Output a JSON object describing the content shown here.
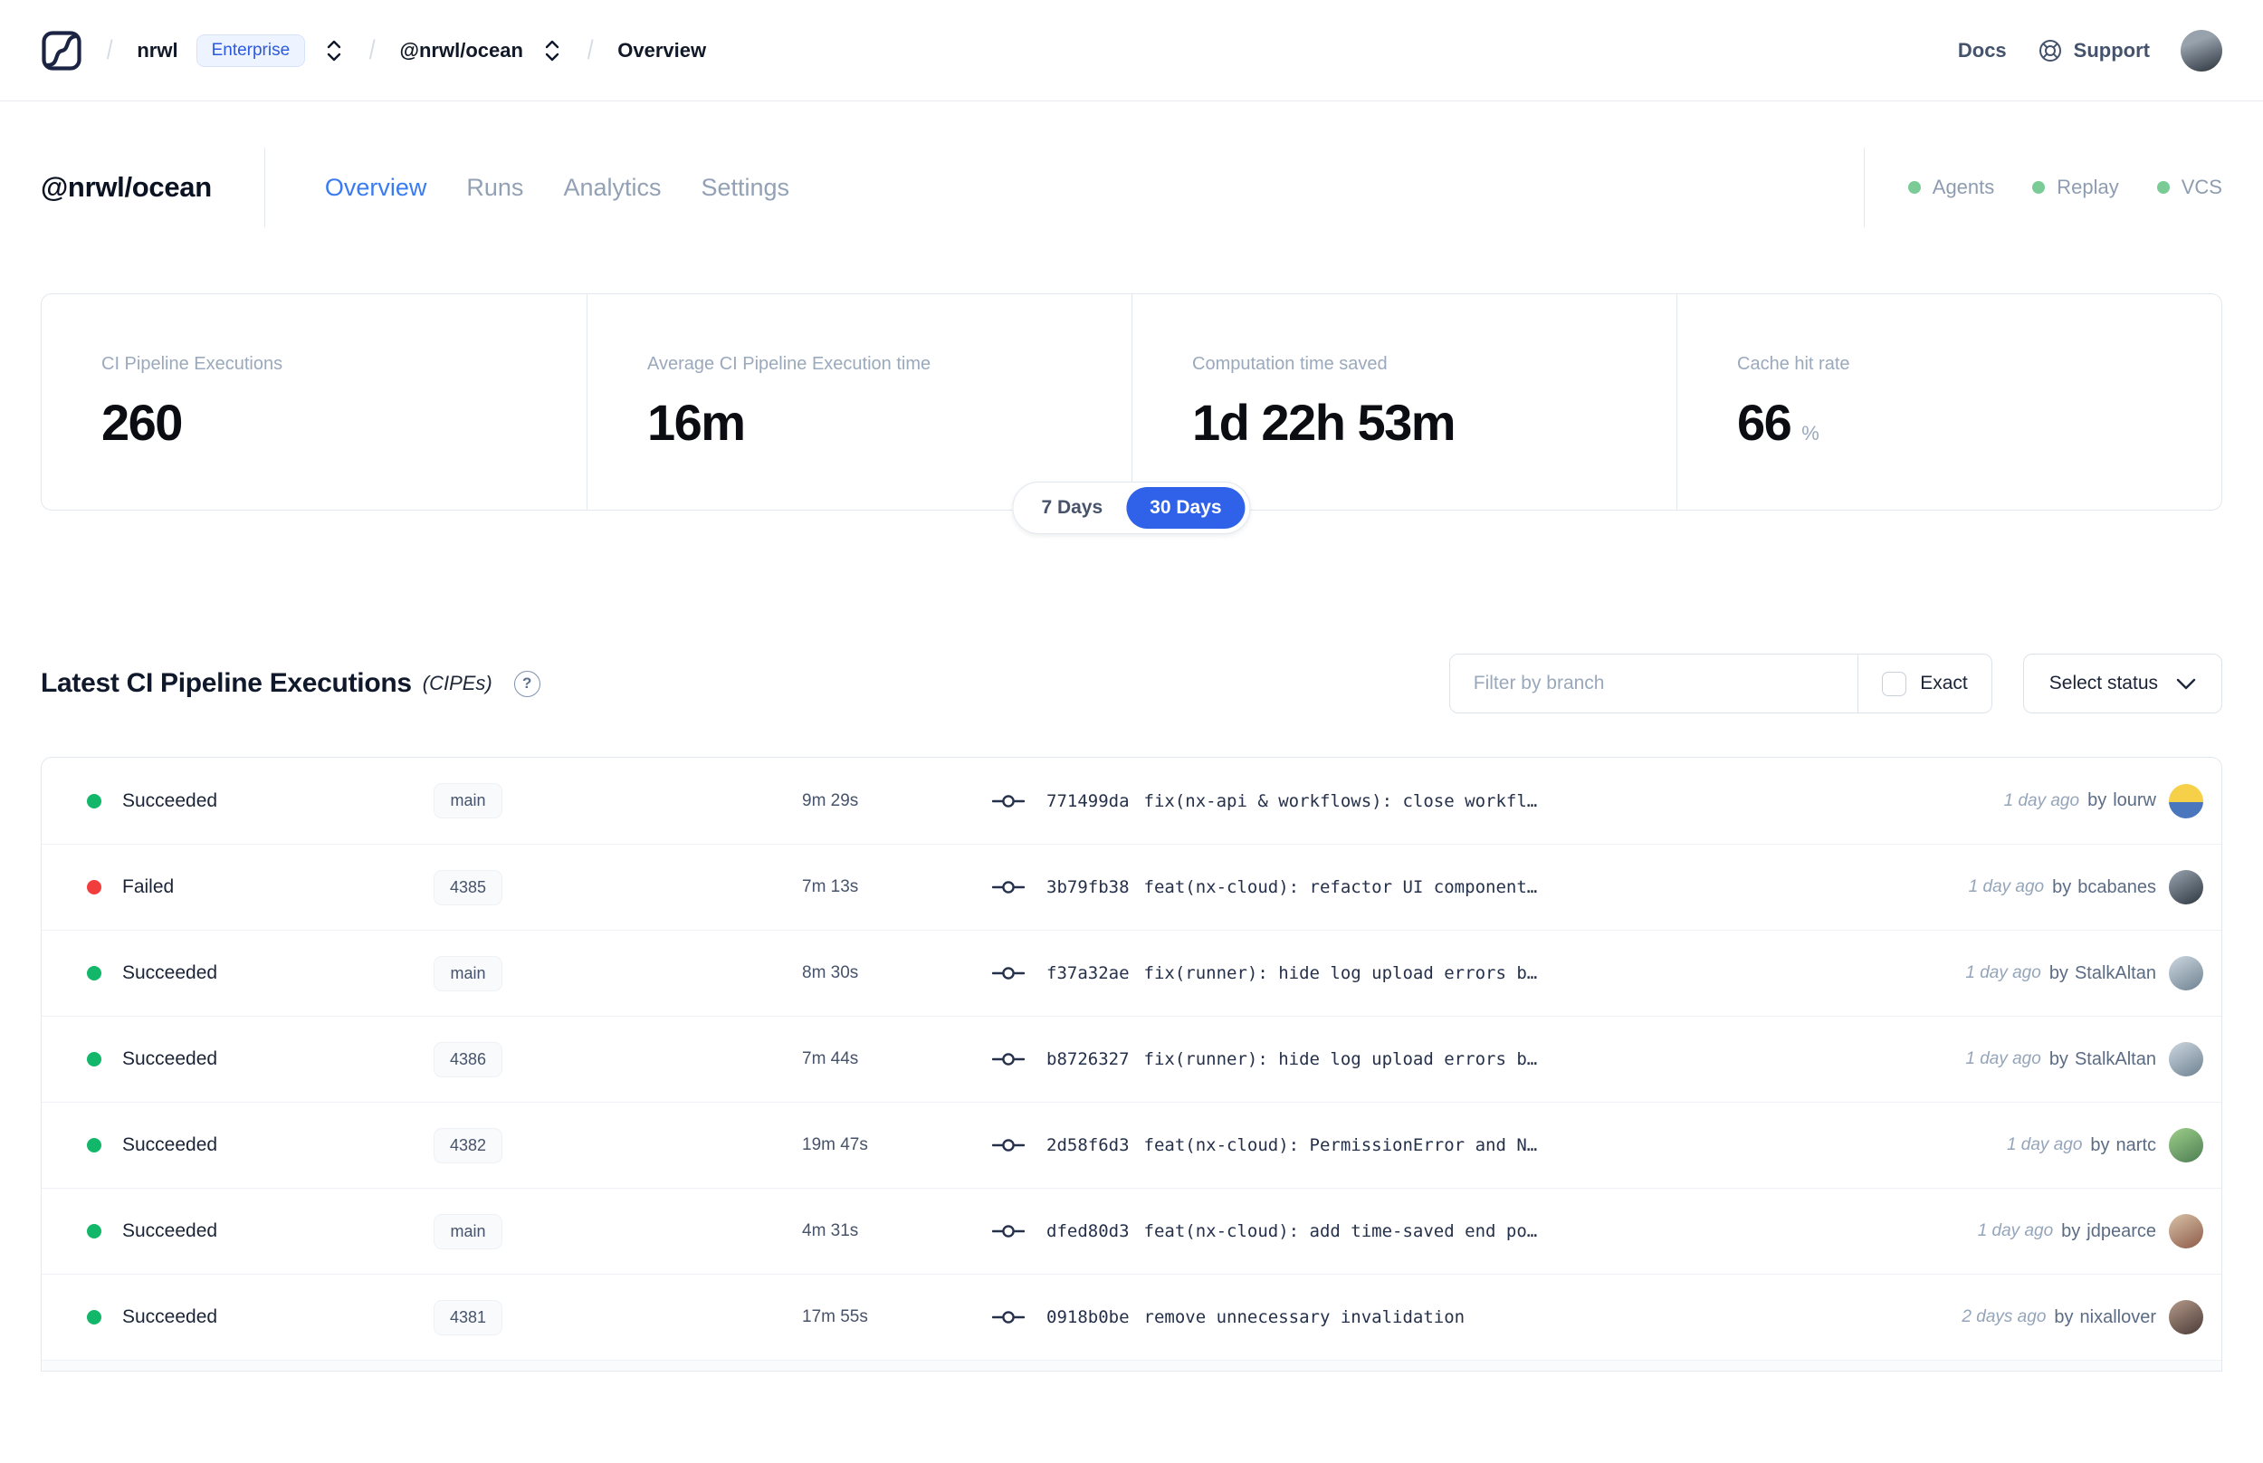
{
  "navbar": {
    "org": "nrwl",
    "plan_badge": "Enterprise",
    "workspace": "@nrwl/ocean",
    "page": "Overview",
    "docs_label": "Docs",
    "support_label": "Support",
    "avatar": {
      "from": "#97a2ac",
      "to": "#2b323c"
    }
  },
  "header": {
    "title": "@nrwl/ocean",
    "tabs": [
      {
        "label": "Overview",
        "active": true
      },
      {
        "label": "Runs",
        "active": false
      },
      {
        "label": "Analytics",
        "active": false
      },
      {
        "label": "Settings",
        "active": false
      }
    ],
    "services": [
      {
        "label": "Agents"
      },
      {
        "label": "Replay"
      },
      {
        "label": "VCS"
      }
    ]
  },
  "stats": {
    "cards": [
      {
        "label": "CI Pipeline Executions",
        "value": "260"
      },
      {
        "label": "Average CI Pipeline Execution time",
        "value": "16m"
      },
      {
        "label": "Computation time saved",
        "value": "1d 22h 53m"
      },
      {
        "label": "Cache hit rate",
        "value": "66",
        "unit": "%"
      }
    ],
    "range_toggle": {
      "options": [
        "7 Days",
        "30 Days"
      ],
      "selected": "30 Days"
    }
  },
  "cipes": {
    "title": "Latest CI Pipeline Executions",
    "subtitle": "(CIPEs)",
    "help_icon": "?",
    "by_label": "by",
    "filter": {
      "placeholder": "Filter by branch",
      "exact_label": "Exact",
      "status_label": "Select status"
    },
    "rows": [
      {
        "status": "Succeeded",
        "status_color": "#12b76a",
        "branch": "main",
        "duration": "9m 29s",
        "hash": "771499da",
        "message": "fix(nx-api & workflows): close workfl…",
        "time_ago": "1 day ago",
        "author": "lourw",
        "avatar": {
          "from": "#f6d049",
          "to": "#4a76bd",
          "split": true
        }
      },
      {
        "status": "Failed",
        "status_color": "#f23d3d",
        "branch": "4385",
        "duration": "7m 13s",
        "hash": "3b79fb38",
        "message": "feat(nx-cloud): refactor UI component…",
        "time_ago": "1 day ago",
        "author": "bcabanes",
        "avatar": {
          "from": "#9aa5b1",
          "to": "#2e3740"
        }
      },
      {
        "status": "Succeeded",
        "status_color": "#12b76a",
        "branch": "main",
        "duration": "8m 30s",
        "hash": "f37a32ae",
        "message": "fix(runner): hide log upload errors b…",
        "time_ago": "1 day ago",
        "author": "StalkAltan",
        "avatar": {
          "from": "#cdd8e0",
          "to": "#6e8191"
        }
      },
      {
        "status": "Succeeded",
        "status_color": "#12b76a",
        "branch": "4386",
        "duration": "7m 44s",
        "hash": "b8726327",
        "message": "fix(runner): hide log upload errors b…",
        "time_ago": "1 day ago",
        "author": "StalkAltan",
        "avatar": {
          "from": "#cdd8e0",
          "to": "#6e8191"
        }
      },
      {
        "status": "Succeeded",
        "status_color": "#12b76a",
        "branch": "4382",
        "duration": "19m 47s",
        "hash": "2d58f6d3",
        "message": "feat(nx-cloud): PermissionError and N…",
        "time_ago": "1 day ago",
        "author": "nartc",
        "avatar": {
          "from": "#9ecf8a",
          "to": "#4c7d52"
        }
      },
      {
        "status": "Succeeded",
        "status_color": "#12b76a",
        "branch": "main",
        "duration": "4m 31s",
        "hash": "dfed80d3",
        "message": "feat(nx-cloud): add time-saved end po…",
        "time_ago": "1 day ago",
        "author": "jdpearce",
        "avatar": {
          "from": "#d9c2a8",
          "to": "#8c5a48"
        }
      },
      {
        "status": "Succeeded",
        "status_color": "#12b76a",
        "branch": "4381",
        "duration": "17m 55s",
        "hash": "0918b0be",
        "message": "remove unnecessary invalidation",
        "time_ago": "2 days ago",
        "author": "nixallover",
        "avatar": {
          "from": "#b59a8a",
          "to": "#4a3a36"
        }
      }
    ]
  },
  "colors": {
    "accent_blue": "#2f62e9",
    "tab_blue": "#3a7bf2",
    "success_green": "#12b76a",
    "failed_red": "#f23d3d",
    "service_green": "#7bcb97"
  }
}
